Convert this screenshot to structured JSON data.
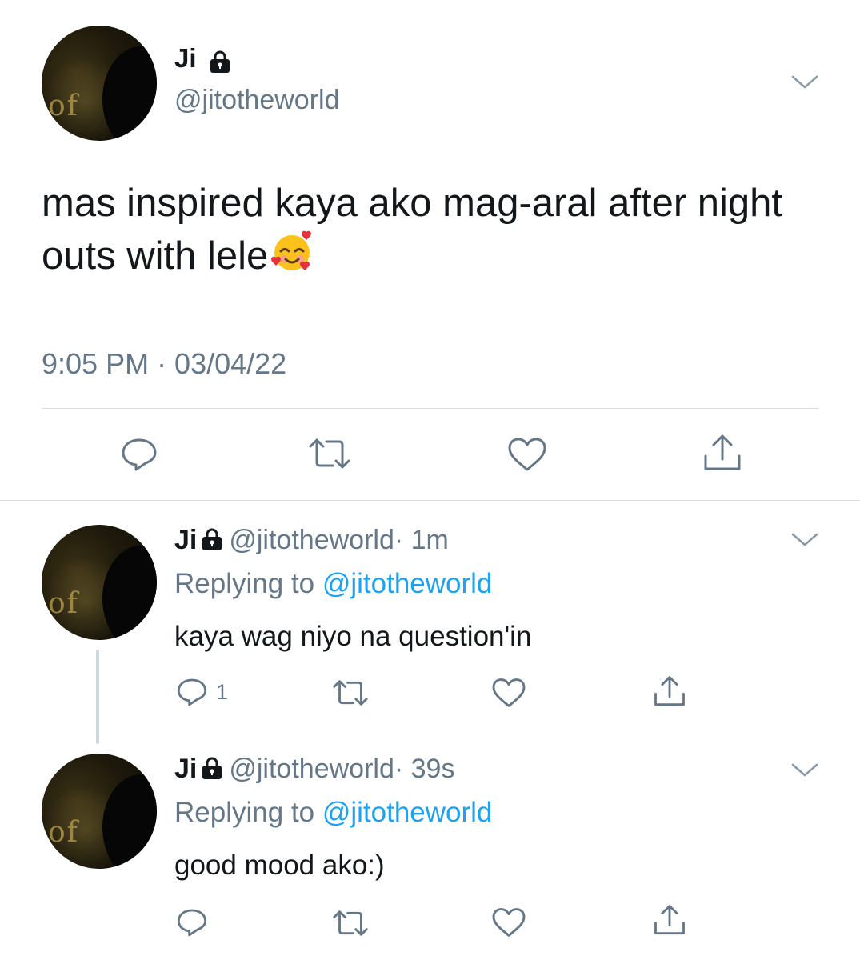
{
  "main_tweet": {
    "display_name": "Ji",
    "handle": "@jitotheworld",
    "text": "mas inspired kaya ako mag-aral after night outs with lele",
    "emoji_icon": "smiling-face-with-hearts-icon",
    "timestamp": "9:05 PM · 03/04/22"
  },
  "replies": [
    {
      "display_name": "Ji",
      "handle": "@jitotheworld",
      "time": "· 1m",
      "replying_prefix": "Replying to ",
      "replying_to": "@jitotheworld",
      "text": "kaya wag niyo na question'in",
      "reply_count": "1"
    },
    {
      "display_name": "Ji",
      "handle": "@jitotheworld",
      "time": "· 39s",
      "replying_prefix": "Replying to ",
      "replying_to": "@jitotheworld",
      "text": "good mood ako:)",
      "reply_count": ""
    }
  ],
  "colors": {
    "text": "#14171a",
    "secondary": "#657786",
    "link": "#1da1f2",
    "divider": "#d9dee3"
  }
}
